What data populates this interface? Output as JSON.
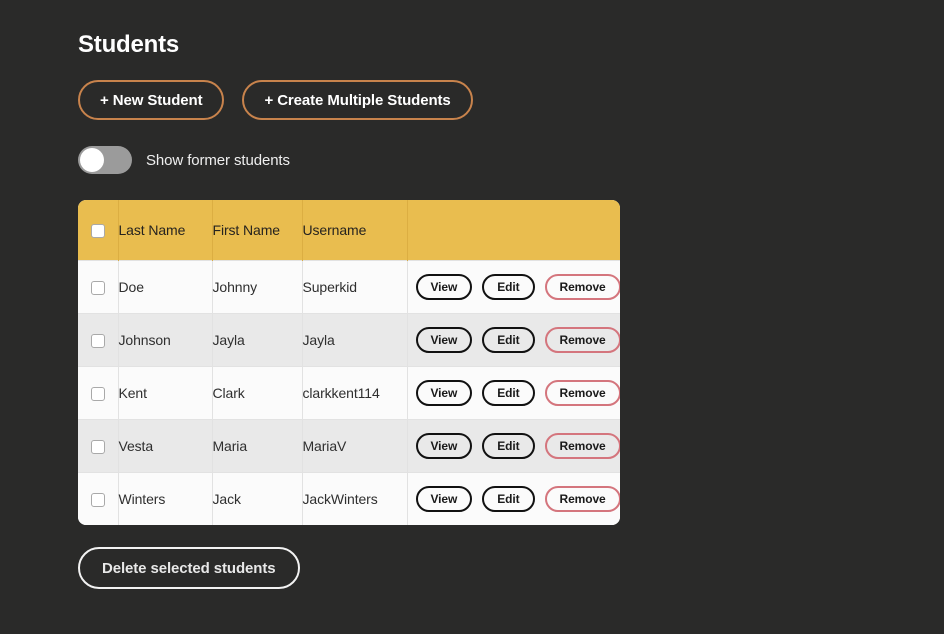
{
  "page": {
    "title": "Students",
    "background_color": "#2a2a29"
  },
  "actions": {
    "new_student_label": "+ New Student",
    "create_multiple_label": "+ Create Multiple Students",
    "accent_color": "#c8834c"
  },
  "toggle": {
    "label": "Show former students",
    "state": "off",
    "track_color": "#9b9b9b",
    "knob_color": "#ffffff"
  },
  "table": {
    "header_color": "#e9bd4f",
    "columns": [
      "",
      "Last Name",
      "First Name",
      "Username",
      ""
    ],
    "select_all_checked": false,
    "row_action_labels": {
      "view": "View",
      "edit": "Edit",
      "remove": "Remove"
    },
    "remove_color": "#d4757d",
    "rows": [
      {
        "checked": false,
        "last_name": "Doe",
        "first_name": "Johnny",
        "username": "Superkid",
        "view": "View",
        "edit": "Edit",
        "remove": "Remove"
      },
      {
        "checked": false,
        "last_name": "Johnson",
        "first_name": "Jayla",
        "username": "Jayla",
        "view": "View",
        "edit": "Edit",
        "remove": "Remove"
      },
      {
        "checked": false,
        "last_name": "Kent",
        "first_name": "Clark",
        "username": "clarkkent114",
        "view": "View",
        "edit": "Edit",
        "remove": "Remove"
      },
      {
        "checked": false,
        "last_name": "Vesta",
        "first_name": "Maria",
        "username": "MariaV",
        "view": "View",
        "edit": "Edit",
        "remove": "Remove"
      },
      {
        "checked": false,
        "last_name": "Winters",
        "first_name": "Jack",
        "username": "JackWinters",
        "view": "View",
        "edit": "Edit",
        "remove": "Remove"
      }
    ]
  },
  "footer": {
    "delete_selected_label": "Delete selected students"
  }
}
